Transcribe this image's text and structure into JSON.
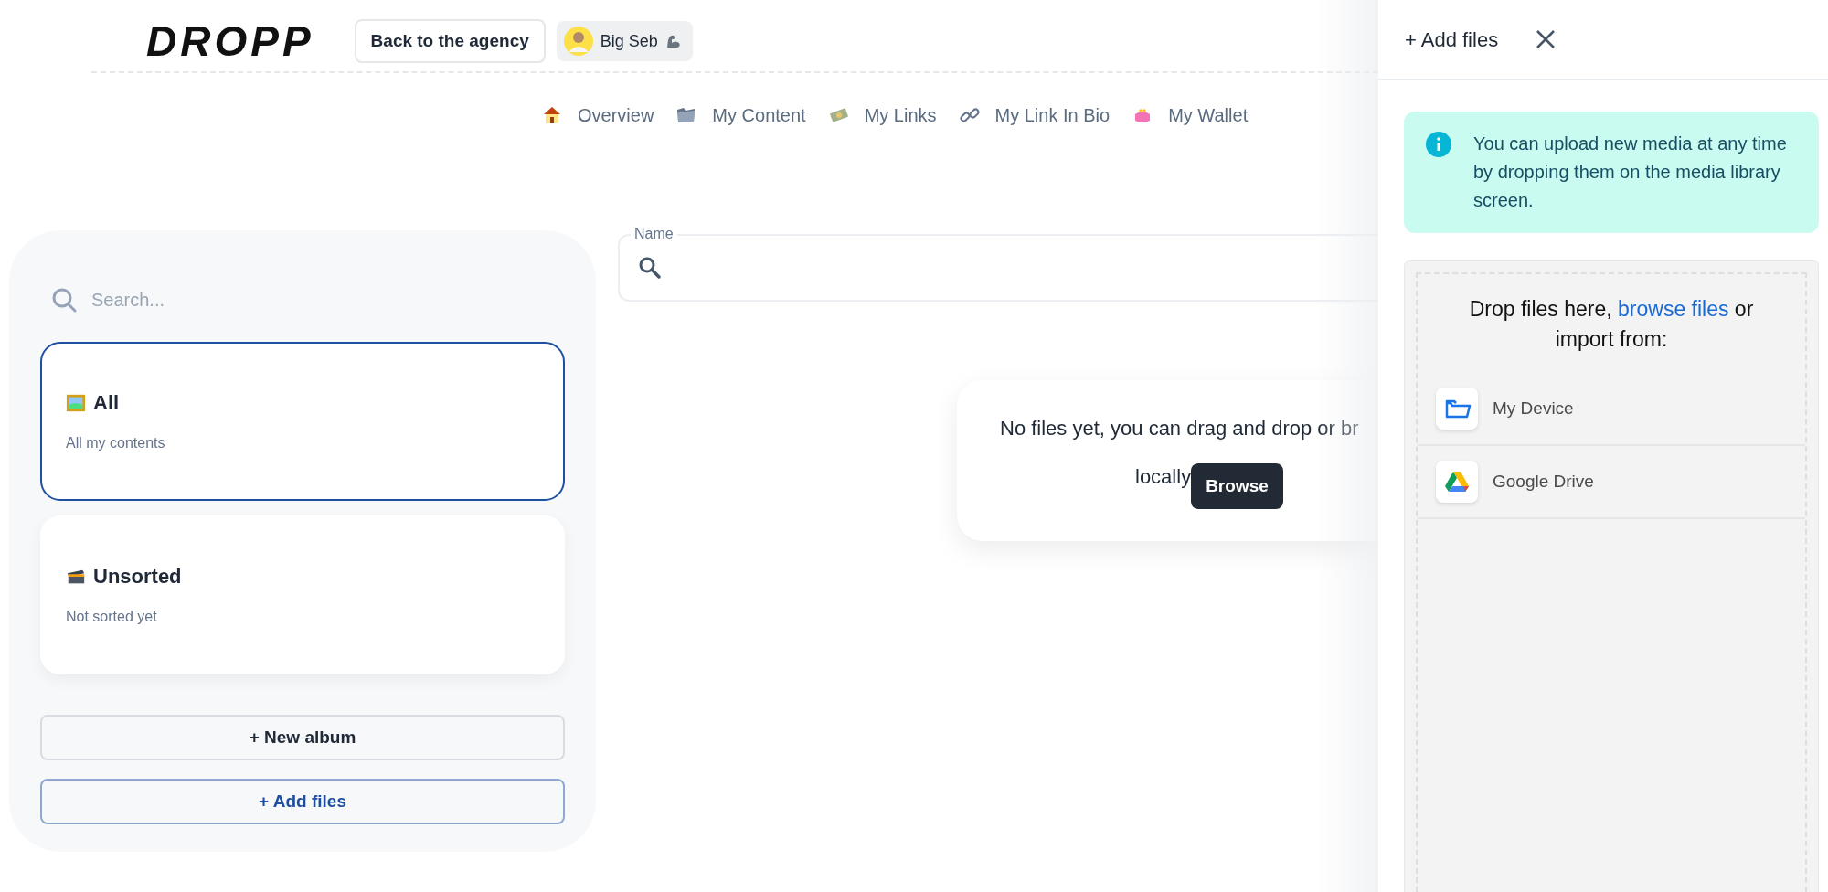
{
  "header": {
    "logo": "DROPP",
    "back_button": "Back to the agency",
    "user": {
      "name": "Big Seb"
    }
  },
  "nav": [
    {
      "label": "Overview",
      "kind": "house"
    },
    {
      "label": "My Content",
      "kind": "folder"
    },
    {
      "label": "My Links",
      "kind": "money"
    },
    {
      "label": "My Link In Bio",
      "kind": "link"
    },
    {
      "label": "My Wallet",
      "kind": "purse"
    }
  ],
  "sidebar": {
    "search": {
      "placeholder": "Search..."
    },
    "albums": [
      {
        "title": "All",
        "subtitle": "All my contents",
        "kind": "frame",
        "selected": true
      },
      {
        "title": "Unsorted",
        "subtitle": "Not sorted yet",
        "kind": "box",
        "selected": false
      }
    ],
    "buttons": [
      {
        "label": "+ New album",
        "kind": "neutral"
      },
      {
        "label": "+ Add files",
        "kind": "primary"
      }
    ]
  },
  "main": {
    "name_field": {
      "label": "Name"
    },
    "empty_state": {
      "message": "No files yet, you can drag and drop or br",
      "message_2": "locally",
      "button": "Browse"
    }
  },
  "drawer": {
    "title": "+ Add files",
    "info": "You can upload new media at any time by dropping them on the media library screen.",
    "drop_prefix": "Drop files here,",
    "drop_link": "browse files",
    "drop_suffix": "or import from:",
    "sources": [
      {
        "label": "My Device",
        "kind": "device"
      },
      {
        "label": "Google Drive",
        "kind": "drive"
      }
    ]
  }
}
